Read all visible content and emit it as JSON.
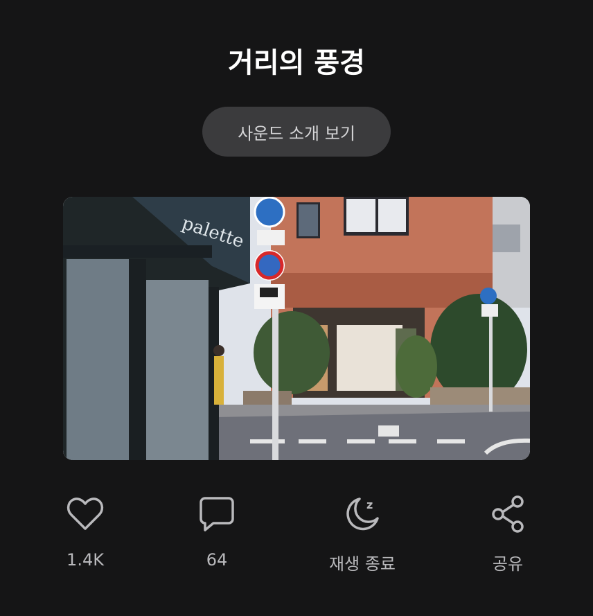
{
  "header": {
    "title": "거리의 풍경"
  },
  "intro_button": {
    "label": "사운드 소개 보기"
  },
  "photo": {
    "storefront_sign": "palette"
  },
  "actions": [
    {
      "id": "like",
      "icon": "heart-icon",
      "label": "1.4K"
    },
    {
      "id": "comment",
      "icon": "comment-bubble-icon",
      "label": "64"
    },
    {
      "id": "sleep_timer",
      "icon": "moon-sleep-icon",
      "label": "재생 종료"
    },
    {
      "id": "share",
      "icon": "share-icon",
      "label": "공유"
    }
  ],
  "colors": {
    "background": "#151516",
    "button_bg": "#3b3b3d",
    "icon_gray": "#b9b9bc"
  }
}
